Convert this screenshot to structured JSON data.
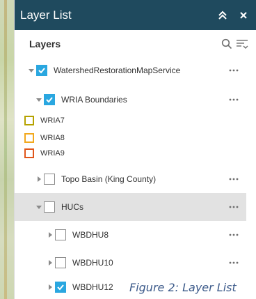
{
  "panel": {
    "title": "Layer List",
    "collapse_icon": "double-chevron-up-icon",
    "close_icon": "close-icon",
    "header_color": "#1f4a5e"
  },
  "toolbar": {
    "label": "Layers",
    "search_icon": "search-icon",
    "filter_icon": "filter-list-icon"
  },
  "layers": [
    {
      "name": "WatershedRestorationMapService",
      "checked": true,
      "expanded": true
    },
    {
      "name": "WRIA Boundaries",
      "checked": true,
      "expanded": true
    },
    {
      "name": "Topo Basin (King County)",
      "checked": false,
      "expanded": false
    },
    {
      "name": "HUCs",
      "checked": false,
      "expanded": true,
      "selected": true
    },
    {
      "name": "WBDHU8",
      "checked": false,
      "expanded": false
    },
    {
      "name": "WBDHU10",
      "checked": false,
      "expanded": false
    },
    {
      "name": "WBDHU12",
      "checked": true,
      "expanded": false
    }
  ],
  "legend": [
    {
      "label": "WRIA7",
      "color": "#b5a200"
    },
    {
      "label": "WRIA8",
      "color": "#f2a91e"
    },
    {
      "label": "WRIA9",
      "color": "#e0561b"
    }
  ],
  "checkbox_color": "#2aa7e0",
  "caption": "Figure 2: Layer List"
}
